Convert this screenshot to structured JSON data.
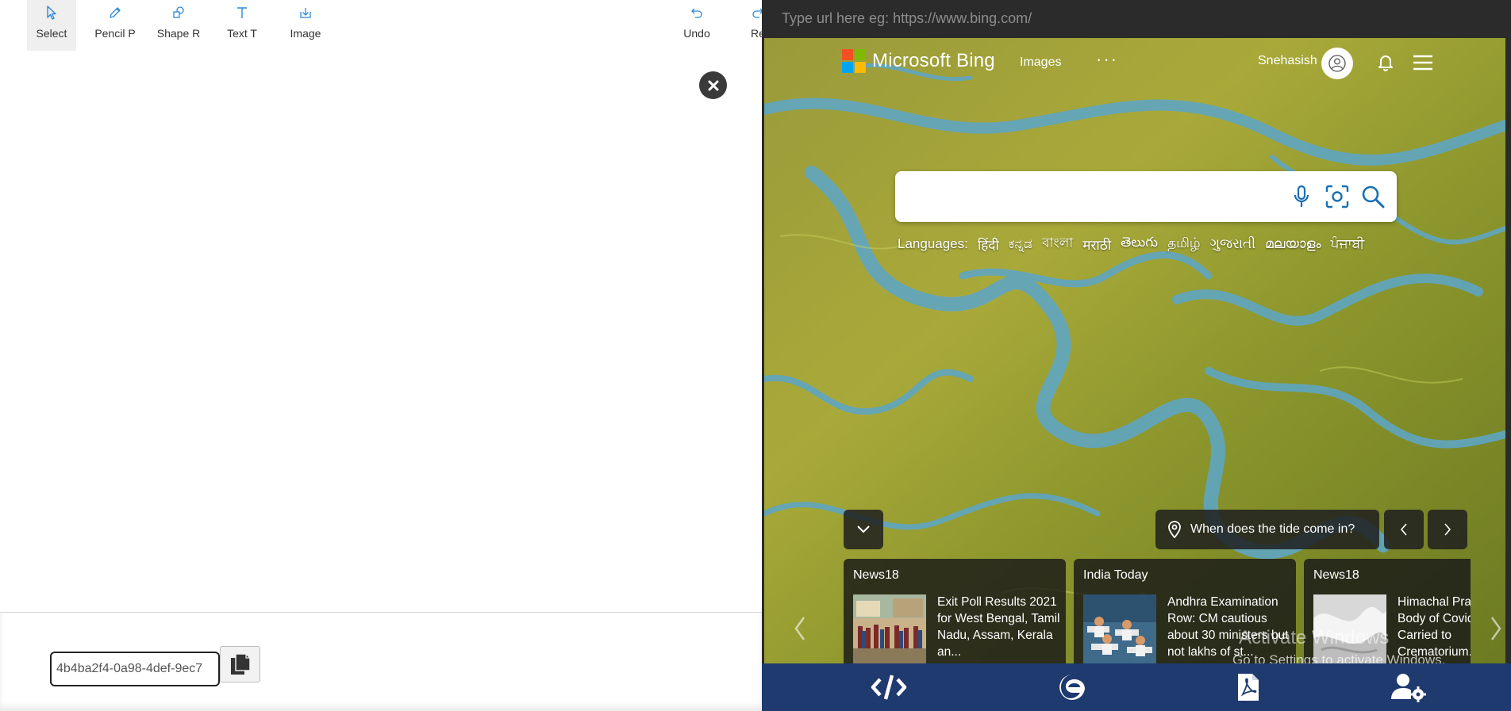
{
  "toolbar": {
    "tools": [
      {
        "label": "Select",
        "icon": "cursor-icon"
      },
      {
        "label": "Pencil P",
        "icon": "pencil-icon"
      },
      {
        "label": "Shape R",
        "icon": "shapes-icon"
      },
      {
        "label": "Text T",
        "icon": "text-icon"
      },
      {
        "label": "Image",
        "icon": "image-download-icon"
      },
      {
        "label": "Undo",
        "icon": "undo-icon"
      },
      {
        "label": "Re",
        "icon": "redo-icon"
      }
    ],
    "active_tool": "Select",
    "accent_color": "#2b88d8"
  },
  "session": {
    "id_value": "4b4ba2f4-0a98-4def-9ec7"
  },
  "browser": {
    "url_placeholder": "Type url here eg: https://www.bing.com/",
    "bing": {
      "brand": "Microsoft Bing",
      "nav_images": "Images",
      "nav_more": "···",
      "username": "Snehasish",
      "languages_label": "Languages:",
      "languages": [
        "हिंदी",
        "ಕನ್ನಡ",
        "বাংলা",
        "मराठी",
        "తెలుగు",
        "தமிழ்",
        "ગુજરાતી",
        "മലയാളം",
        "ਪੰਜਾਬੀ"
      ],
      "tide_question": "When does the tide come in?",
      "news": [
        {
          "source": "News18",
          "title": "Exit Poll Results 2021 for West Bengal, Tamil Nadu, Assam, Kerala an..."
        },
        {
          "source": "India Today",
          "title": "Andhra Examination Row: CM cautious about 30 ministers but not lakhs of st..."
        },
        {
          "source": "News18",
          "title": "Himachal Pradesh: Body of Covid Victim Carried to Crematorium..."
        }
      ]
    },
    "watermark": {
      "title": "Activate Windows",
      "subtitle": "Go to Settings to activate Windows."
    },
    "dock": {
      "items": [
        "code-icon",
        "edge-icon",
        "pdf-icon",
        "user-settings-icon"
      ],
      "bg_color": "#1e3a6e"
    }
  }
}
